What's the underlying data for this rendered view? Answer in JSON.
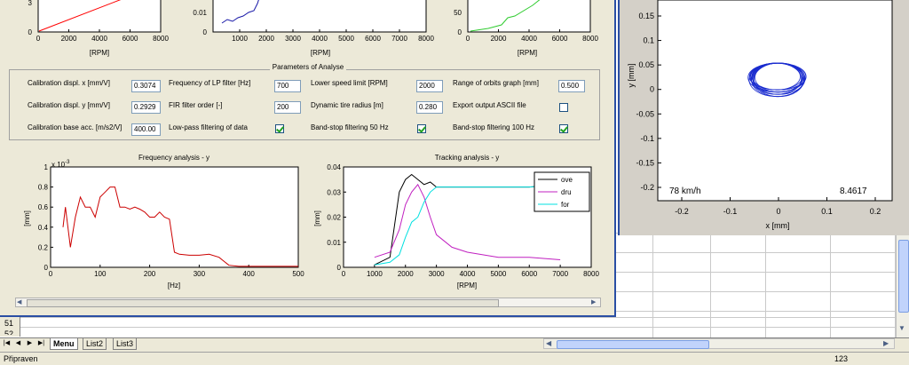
{
  "top_plots": {
    "left_x_ticks": [
      "0",
      "2000",
      "4000",
      "6000",
      "8000"
    ],
    "left_y_ticks": [
      "0"
    ],
    "left_x_label": "[RPM]",
    "middle_x_ticks": [
      "1000",
      "2000",
      "3000",
      "4000",
      "5000",
      "6000",
      "7000",
      "8000"
    ],
    "middle_y_ticks": [
      "0.01",
      "0"
    ],
    "middle_x_label": "[RPM]",
    "right_x_ticks": [
      "0",
      "2000",
      "4000",
      "6000",
      "8000"
    ],
    "right_y_ticks": [
      "50",
      "0"
    ],
    "right_x_label": "[RPM]"
  },
  "params": {
    "title": "Parameters of Analyse",
    "calib_x_label": "Calibration displ. x [mm/V]",
    "calib_x_value": "0.3074",
    "calib_y_label": "Calibration displ. y [mm/V]",
    "calib_y_value": "0.2929",
    "calib_acc_label": "Calibration base acc. [m/s2/V]",
    "calib_acc_value": "400.00",
    "lp_freq_label": "Frequency of LP filter [Hz]",
    "lp_freq_value": "700",
    "fir_label": "FIR filter order [-]",
    "fir_value": "200",
    "lowpass_label": "Low-pass filtering of data",
    "lower_speed_label": "Lower speed limit [RPM]",
    "lower_speed_value": "2000",
    "tire_label": "Dynamic tire radius [m]",
    "tire_value": "0.280",
    "bs50_label": "Band-stop filtering 50 Hz",
    "range_label": "Range of orbits graph [mm]",
    "range_value": "0.500",
    "export_label": "Export output ASCII file",
    "bs100_label": "Band-stop filtering 100 Hz",
    "checks": {
      "lowpass": true,
      "bs50": true,
      "export": false,
      "bs100": true
    }
  },
  "freq_chart": {
    "title": "Frequency analysis - y",
    "exponent": "x 10",
    "exponent_power": "-3",
    "ylabel": "[mm]",
    "xlabel": "[Hz]",
    "x_ticks": [
      "0",
      "100",
      "200",
      "300",
      "400",
      "500"
    ],
    "y_ticks": [
      "1",
      "0.8",
      "0.6",
      "0.4",
      "0.2",
      "0"
    ]
  },
  "track_chart": {
    "title": "Tracking analysis - y",
    "ylabel": "[mm]",
    "xlabel": "[RPM]",
    "x_ticks": [
      "0",
      "1000",
      "2000",
      "3000",
      "4000",
      "5000",
      "6000",
      "7000",
      "8000"
    ],
    "y_ticks": [
      "0.04",
      "0.03",
      "0.02",
      "0.01",
      "0"
    ],
    "legend": [
      {
        "name": "ove",
        "color": "#000000"
      },
      {
        "name": "dru",
        "color": "#c020c0"
      },
      {
        "name": "for",
        "color": "#00e0e0"
      }
    ]
  },
  "orbit_chart": {
    "y_ticks": [
      "0.15",
      "0.1",
      "0.05",
      "0",
      "-0.05",
      "-0.1",
      "-0.15",
      "-0.2"
    ],
    "x_ticks": [
      "-0.2",
      "-0.1",
      "0",
      "0.1",
      "0.2"
    ],
    "ylabel": "y [mm]",
    "xlabel": "x [mm]",
    "speed_text": "78 km/h",
    "value_text": "8.4617"
  },
  "excel": {
    "row_numbers": [
      "51",
      "52"
    ],
    "sheet_tabs": [
      "Menu",
      "List2",
      "List3"
    ],
    "status_left": "Připraven",
    "status_right": "123"
  },
  "chart_data": [
    {
      "type": "line",
      "title": "Frequency analysis - y",
      "xlabel": "[Hz]",
      "ylabel": "[mm]",
      "xlim": [
        0,
        500
      ],
      "ylim": [
        0,
        0.001
      ],
      "series": [
        {
          "x": [
            25,
            30,
            40,
            50,
            60,
            70,
            80,
            90,
            100,
            110,
            120,
            130,
            140,
            150,
            160,
            170,
            180,
            190,
            200,
            210,
            220,
            230,
            240,
            250,
            260,
            280,
            300,
            320,
            340,
            360,
            380,
            400,
            450,
            500
          ],
          "values": [
            0.0004,
            0.0006,
            0.0002,
            0.0005,
            0.0007,
            0.0006,
            0.0006,
            0.0005,
            0.0007,
            0.00075,
            0.0008,
            0.0008,
            0.0006,
            0.0006,
            0.00058,
            0.0006,
            0.00058,
            0.00055,
            0.0005,
            0.0005,
            0.00055,
            0.0005,
            0.00048,
            0.00015,
            0.00013,
            0.00012,
            0.00012,
            0.00013,
            0.0001,
            2e-05,
            1e-05,
            1e-05,
            1e-05,
            1e-05
          ]
        }
      ]
    },
    {
      "type": "line",
      "title": "Tracking analysis - y",
      "xlabel": "[RPM]",
      "ylabel": "[mm]",
      "xlim": [
        0,
        8000
      ],
      "ylim": [
        0,
        0.04
      ],
      "categories_x": [
        1000,
        1500,
        1800,
        2000,
        2200,
        2400,
        2600,
        2800,
        3000,
        3500,
        4000,
        5000,
        6000,
        7000
      ],
      "series": [
        {
          "name": "ove",
          "values": [
            0.001,
            0.004,
            0.03,
            0.035,
            0.037,
            0.035,
            0.033,
            0.034,
            0.032,
            0.032,
            0.032,
            0.032,
            0.032,
            0.033
          ]
        },
        {
          "name": "dru",
          "values": [
            0.004,
            0.006,
            0.015,
            0.025,
            0.03,
            0.033,
            0.028,
            0.02,
            0.013,
            0.008,
            0.006,
            0.004,
            0.004,
            0.003
          ]
        },
        {
          "name": "for",
          "values": [
            0.001,
            0.002,
            0.005,
            0.012,
            0.018,
            0.02,
            0.026,
            0.03,
            0.032,
            0.032,
            0.032,
            0.032,
            0.032,
            0.033
          ]
        }
      ]
    }
  ]
}
